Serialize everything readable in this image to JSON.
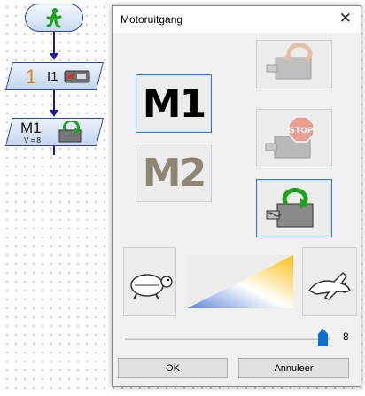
{
  "flowchart": {
    "input_number": "1",
    "input_label": "I1",
    "motor_label": "M1",
    "motor_speed_text": "V = 8"
  },
  "dialog": {
    "title": "Motoruitgang",
    "motor_buttons": [
      "M1",
      "M2"
    ],
    "action_icons": [
      "rotate-left-icon",
      "stop-icon",
      "rotate-right-icon"
    ],
    "slow_icon": "turtle-icon",
    "fast_icon": "rabbit-icon",
    "speed_value": "8",
    "speed_fraction": 1.0,
    "ok_label": "OK",
    "cancel_label": "Annuleer"
  },
  "colors": {
    "selection_border": "#3a7bd5",
    "flow_arrow": "#1a1aa0",
    "slider_thumb": "#0a6fd6",
    "gradient_low": "#5e86d9",
    "gradient_high": "#f7be18"
  }
}
